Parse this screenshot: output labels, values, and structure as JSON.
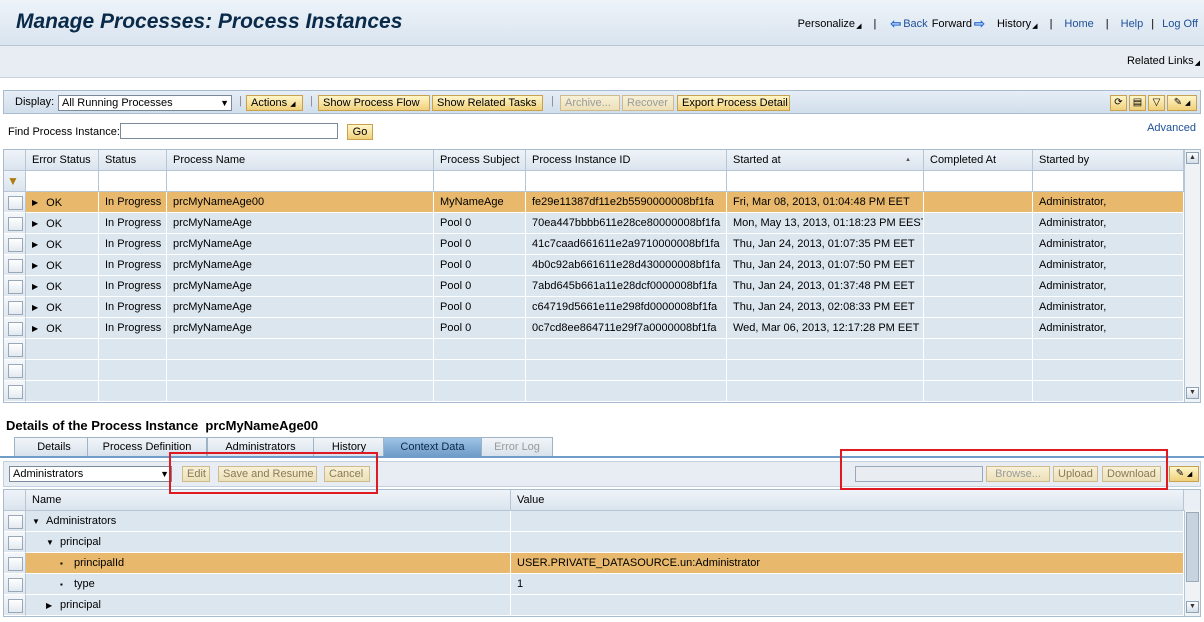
{
  "header": {
    "title": "Manage Processes: Process Instances",
    "nav": {
      "personalize": "Personalize",
      "back": "Back",
      "forward": "Forward",
      "history": "History",
      "home": "Home",
      "help": "Help",
      "logoff": "Log Off"
    },
    "related_links": "Related Links"
  },
  "toolbar": {
    "display_label": "Display:",
    "display_value": "All Running Processes",
    "actions": "Actions",
    "show_process_flow": "Show Process Flow",
    "show_related_tasks": "Show Related Tasks",
    "archive": "Archive...",
    "recover": "Recover",
    "export_process_detail": "Export Process Detail"
  },
  "find": {
    "label": "Find Process Instance:",
    "value": "",
    "go": "Go",
    "advanced": "Advanced"
  },
  "instances_table": {
    "columns": [
      "Error Status",
      "Status",
      "Process Name",
      "Process Subject",
      "Process Instance ID",
      "Started at",
      "Completed At",
      "Started by"
    ],
    "rows": [
      [
        "OK",
        "In Progress",
        "prcMyNameAge00",
        "MyNameAge",
        "fe29e11387df11e2b5590000008bf1fa",
        "Fri, Mar 08, 2013, 01:04:48 PM EET",
        "",
        "Administrator,"
      ],
      [
        "OK",
        "In Progress",
        "prcMyNameAge",
        "Pool 0",
        "70ea447bbbb611e28ce80000008bf1fa",
        "Mon, May 13, 2013, 01:18:23 PM EEST",
        "",
        "Administrator,"
      ],
      [
        "OK",
        "In Progress",
        "prcMyNameAge",
        "Pool 0",
        "41c7caad661611e2a9710000008bf1fa",
        "Thu, Jan 24, 2013, 01:07:35 PM EET",
        "",
        "Administrator,"
      ],
      [
        "OK",
        "In Progress",
        "prcMyNameAge",
        "Pool 0",
        "4b0c92ab661611e28d430000008bf1fa",
        "Thu, Jan 24, 2013, 01:07:50 PM EET",
        "",
        "Administrator,"
      ],
      [
        "OK",
        "In Progress",
        "prcMyNameAge",
        "Pool 0",
        "7abd645b661a11e28dcf0000008bf1fa",
        "Thu, Jan 24, 2013, 01:37:48 PM EET",
        "",
        "Administrator,"
      ],
      [
        "OK",
        "In Progress",
        "prcMyNameAge",
        "Pool 0",
        "c64719d5661e11e298fd0000008bf1fa",
        "Thu, Jan 24, 2013, 02:08:33 PM EET",
        "",
        "Administrator,"
      ],
      [
        "OK",
        "In Progress",
        "prcMyNameAge",
        "Pool 0",
        "0c7cd8ee864711e29f7a0000008bf1fa",
        "Wed, Mar 06, 2013, 12:17:28 PM EET",
        "",
        "Administrator,"
      ]
    ]
  },
  "details": {
    "title_prefix": "Details of the Process Instance",
    "instance_name": "prcMyNameAge00",
    "tabs": [
      "Details",
      "Process Definition",
      "Administrators",
      "History",
      "Context Data",
      "Error Log"
    ],
    "context_select": "Administrators",
    "edit": "Edit",
    "save_and_resume": "Save and Resume",
    "cancel": "Cancel",
    "browse": "Browse...",
    "upload": "Upload",
    "download": "Download"
  },
  "context_table": {
    "columns": [
      "Name",
      "Value"
    ],
    "rows": [
      {
        "name": "Administrators",
        "value": "",
        "marker": "▼"
      },
      {
        "name": "principal",
        "value": "",
        "marker": "▼"
      },
      {
        "name": "principalId",
        "value": "USER.PRIVATE_DATASOURCE.un:Administrator",
        "marker": "▪"
      },
      {
        "name": "type",
        "value": "1",
        "marker": "▪"
      },
      {
        "name": "principal",
        "value": "",
        "marker": "▶"
      }
    ]
  },
  "colors": {
    "selected_row": "#e8b96c",
    "highlight_box": "#e01a22"
  }
}
